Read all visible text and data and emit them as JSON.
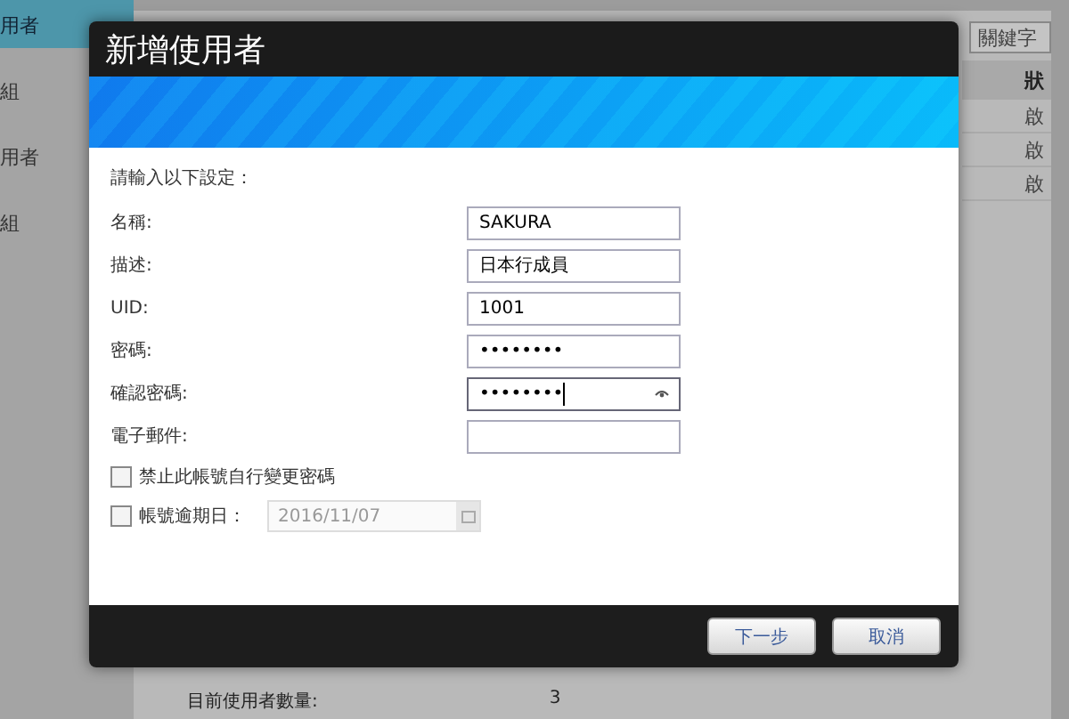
{
  "background": {
    "sidebar": {
      "items": [
        {
          "label": "用者",
          "selected": true
        },
        {
          "label": "組",
          "selected": false
        },
        {
          "label": "用者",
          "selected": false
        },
        {
          "label": "組",
          "selected": false
        }
      ]
    },
    "search": {
      "placeholder": "關鍵字"
    },
    "table": {
      "column_header": "狀",
      "rows": [
        "啟",
        "啟",
        "啟"
      ]
    },
    "stats": [
      {
        "label": "目前使用者數量:",
        "value": "3"
      }
    ]
  },
  "dialog": {
    "title": "新增使用者",
    "instruction": "請輸入以下設定：",
    "fields": [
      {
        "label": "名稱:",
        "value": "SAKURA",
        "focused": false
      },
      {
        "label": "描述:",
        "value": "日本行成員",
        "focused": false
      },
      {
        "label": "UID:",
        "value": "1001",
        "focused": false
      },
      {
        "label": "密碼:",
        "value": "••••••••",
        "focused": false
      },
      {
        "label": "確認密碼:",
        "value": "••••••••",
        "focused": true
      },
      {
        "label": "電子郵件:",
        "focused": false
      }
    ],
    "options": [
      {
        "label": "禁止此帳號自行變更密碼",
        "checked": false
      },
      {
        "label": "帳號逾期日：",
        "checked": false,
        "date": "2016/11/07"
      }
    ],
    "buttons": [
      "下一步",
      "取消"
    ]
  }
}
